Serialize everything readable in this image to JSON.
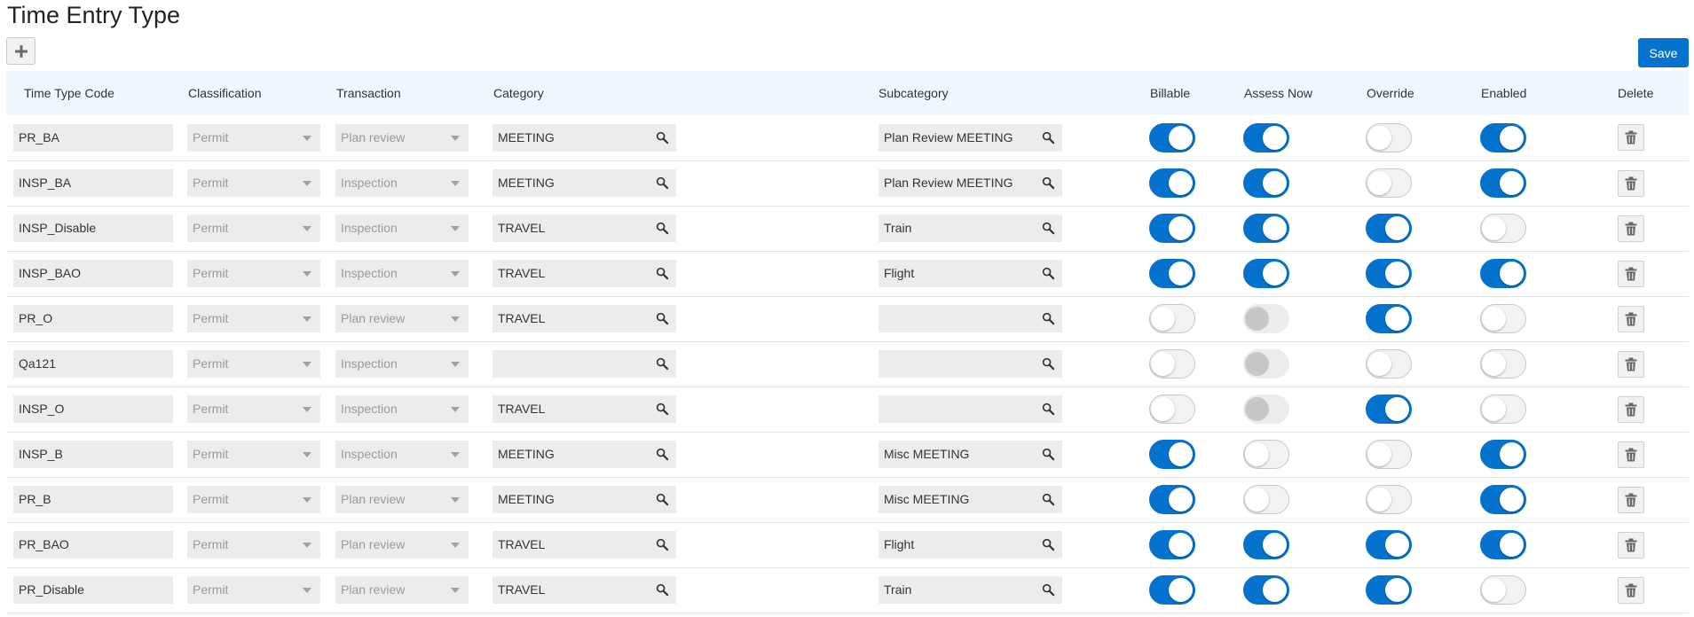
{
  "page": {
    "title": "Time Entry Type"
  },
  "toolbar": {
    "add_icon": "plus-icon",
    "save_label": "Save"
  },
  "colors": {
    "accent": "#0572ce",
    "header_bg": "#eef7fd",
    "field_bg": "#ececec"
  },
  "columns": [
    "Time Type Code",
    "Classification",
    "Transaction",
    "Category",
    "Subcategory",
    "Billable",
    "Assess Now",
    "Override",
    "Enabled",
    "Delete"
  ],
  "rows": [
    {
      "code": "PR_BA",
      "classification": "Permit",
      "transaction": "Plan review",
      "category": "MEETING",
      "subcategory": "Plan Review MEETING",
      "billable": "on",
      "assess": "on",
      "override": "off",
      "enabled": "on"
    },
    {
      "code": "INSP_BA",
      "classification": "Permit",
      "transaction": "Inspection",
      "category": "MEETING",
      "subcategory": "Plan Review MEETING",
      "billable": "on",
      "assess": "on",
      "override": "off",
      "enabled": "on"
    },
    {
      "code": "INSP_Disable",
      "classification": "Permit",
      "transaction": "Inspection",
      "category": "TRAVEL",
      "subcategory": "Train",
      "billable": "on",
      "assess": "on",
      "override": "on",
      "enabled": "off"
    },
    {
      "code": "INSP_BAO",
      "classification": "Permit",
      "transaction": "Inspection",
      "category": "TRAVEL",
      "subcategory": "Flight",
      "billable": "on",
      "assess": "on",
      "override": "on",
      "enabled": "on"
    },
    {
      "code": "PR_O",
      "classification": "Permit",
      "transaction": "Plan review",
      "category": "TRAVEL",
      "subcategory": "",
      "billable": "off",
      "assess": "disabled",
      "override": "on",
      "enabled": "off"
    },
    {
      "code": "Qa121",
      "classification": "Permit",
      "transaction": "Inspection",
      "category": "",
      "subcategory": "",
      "billable": "off",
      "assess": "disabled",
      "override": "off",
      "enabled": "off"
    },
    {
      "code": "INSP_O",
      "classification": "Permit",
      "transaction": "Inspection",
      "category": "TRAVEL",
      "subcategory": "",
      "billable": "off",
      "assess": "disabled",
      "override": "on",
      "enabled": "off"
    },
    {
      "code": "INSP_B",
      "classification": "Permit",
      "transaction": "Inspection",
      "category": "MEETING",
      "subcategory": "Misc MEETING",
      "billable": "on",
      "assess": "off",
      "override": "off",
      "enabled": "on"
    },
    {
      "code": "PR_B",
      "classification": "Permit",
      "transaction": "Plan review",
      "category": "MEETING",
      "subcategory": "Misc MEETING",
      "billable": "on",
      "assess": "off",
      "override": "off",
      "enabled": "on"
    },
    {
      "code": "PR_BAO",
      "classification": "Permit",
      "transaction": "Plan review",
      "category": "TRAVEL",
      "subcategory": "Flight",
      "billable": "on",
      "assess": "on",
      "override": "on",
      "enabled": "on"
    },
    {
      "code": "PR_Disable",
      "classification": "Permit",
      "transaction": "Plan review",
      "category": "TRAVEL",
      "subcategory": "Train",
      "billable": "on",
      "assess": "on",
      "override": "on",
      "enabled": "off"
    }
  ]
}
